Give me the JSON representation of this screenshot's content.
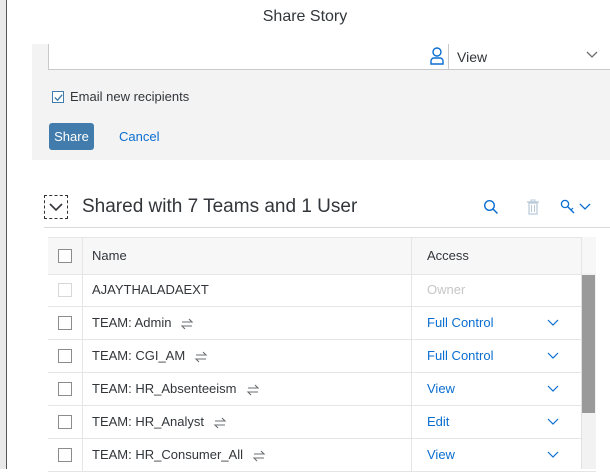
{
  "dialog": {
    "title": "Share Story"
  },
  "share_form": {
    "recipient_value": "",
    "access_value": "View",
    "email_label": "Email new recipients",
    "email_checked": true,
    "share_label": "Share",
    "cancel_label": "Cancel"
  },
  "shared_list": {
    "title": "Shared with 7 Teams and 1 User",
    "columns": {
      "name": "Name",
      "access": "Access"
    },
    "rows": [
      {
        "name": "AJAYTHALADAEXT",
        "access": "Owner",
        "team": false
      },
      {
        "name": "TEAM: Admin",
        "access": "Full Control",
        "team": true
      },
      {
        "name": "TEAM: CGI_AM",
        "access": "Full Control",
        "team": true
      },
      {
        "name": "TEAM: HR_Absenteeism",
        "access": "View",
        "team": true
      },
      {
        "name": "TEAM: HR_Analyst",
        "access": "Edit",
        "team": true
      },
      {
        "name": "TEAM: HR_Consumer_All",
        "access": "View",
        "team": true
      }
    ]
  },
  "icons": {
    "recipient": "person-icon",
    "dropdown": "chevron-down-icon",
    "search": "search-icon",
    "delete": "trash-icon",
    "settings": "key-settings-icon",
    "sync": "sync-arrows-icon",
    "collapse": "collapse-toggle-icon"
  },
  "colors": {
    "accent": "#427cac",
    "link": "#0a6ed1",
    "panel": "#f3f3f3"
  }
}
